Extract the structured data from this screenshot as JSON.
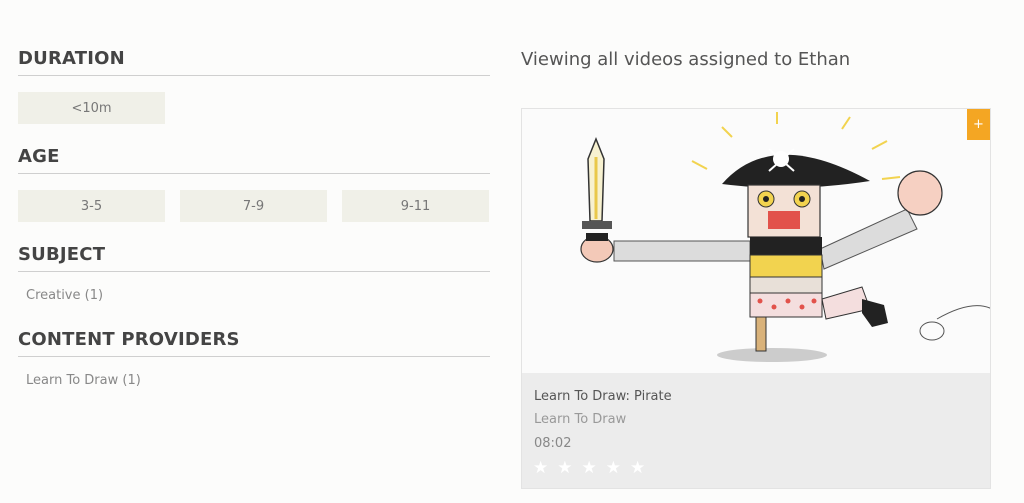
{
  "filters": {
    "duration": {
      "title": "DURATION",
      "chips": [
        "<10m"
      ]
    },
    "age": {
      "title": "AGE",
      "chips": [
        "3-5",
        "7-9",
        "9-11"
      ]
    },
    "subject": {
      "title": "SUBJECT",
      "items": [
        "Creative (1)"
      ]
    },
    "providers": {
      "title": "CONTENT PROVIDERS",
      "items": [
        "Learn To Draw (1)"
      ]
    }
  },
  "main": {
    "heading": "Viewing all videos assigned to Ethan",
    "card": {
      "add_label": "+",
      "title": "Learn To Draw: Pirate",
      "provider": "Learn To Draw",
      "duration": "08:02",
      "rating": 0,
      "max_rating": 5,
      "accent_color": "#f4a623"
    }
  }
}
